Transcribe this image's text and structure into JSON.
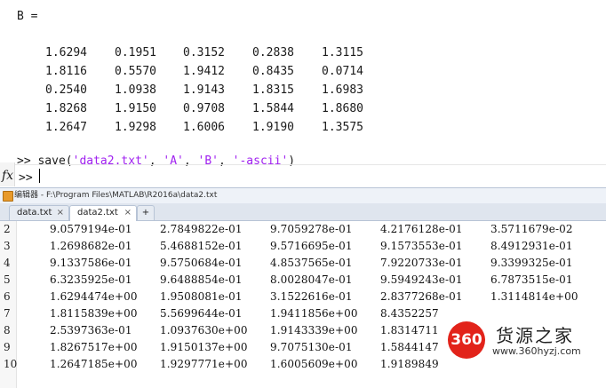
{
  "command_window": {
    "var_label": "B =",
    "matrix": [
      [
        "1.6294",
        "0.1951",
        "0.3152",
        "0.2838",
        "1.3115"
      ],
      [
        "1.8116",
        "0.5570",
        "1.9412",
        "0.8435",
        "0.0714"
      ],
      [
        "0.2540",
        "1.0938",
        "1.9143",
        "1.8315",
        "1.6983"
      ],
      [
        "1.8268",
        "1.9150",
        "0.9708",
        "1.5844",
        "1.8680"
      ],
      [
        "1.2647",
        "1.9298",
        "1.6006",
        "1.9190",
        "1.3575"
      ]
    ],
    "prompt": ">>",
    "command_prefix": "save(",
    "arg1": "'data2.txt'",
    "sep1": ", ",
    "arg2": "'A'",
    "sep2": ", ",
    "arg3": "'B'",
    "sep3": ", ",
    "arg4": "'-ascii'",
    "command_suffix": ")",
    "fx_symbol": "fx",
    "prompt2": ">>"
  },
  "editor": {
    "title": "编辑器 - F:\\Program Files\\MATLAB\\R2016a\\data2.txt",
    "tabs": [
      {
        "label": "data.txt",
        "close": "×"
      },
      {
        "label": "data2.txt",
        "close": "×"
      }
    ],
    "add_tab": "+",
    "lines": [
      {
        "num": "2",
        "values": [
          "9.0579194e-01",
          "2.7849822e-01",
          "9.7059278e-01",
          "4.2176128e-01",
          "3.5711679e-02"
        ]
      },
      {
        "num": "3",
        "values": [
          "1.2698682e-01",
          "5.4688152e-01",
          "9.5716695e-01",
          "9.1573553e-01",
          "8.4912931e-01"
        ]
      },
      {
        "num": "4",
        "values": [
          "9.1337586e-01",
          "9.5750684e-01",
          "4.8537565e-01",
          "7.9220733e-01",
          "9.3399325e-01"
        ]
      },
      {
        "num": "5",
        "values": [
          "6.3235925e-01",
          "9.6488854e-01",
          "8.0028047e-01",
          "9.5949243e-01",
          "6.7873515e-01"
        ]
      },
      {
        "num": "6",
        "values": [
          "1.6294474e+00",
          "1.9508081e-01",
          "3.1522616e-01",
          "2.8377268e-01",
          "1.3114814e+00"
        ]
      },
      {
        "num": "7",
        "values": [
          "1.8115839e+00",
          "5.5699644e-01",
          "1.9411856e+00",
          "8.4352257",
          ""
        ]
      },
      {
        "num": "8",
        "values": [
          "2.5397363e-01",
          "1.0937630e+00",
          "1.9143339e+00",
          "1.8314711",
          ""
        ]
      },
      {
        "num": "9",
        "values": [
          "1.8267517e+00",
          "1.9150137e+00",
          "9.7075130e-01",
          "1.5844147",
          ""
        ]
      },
      {
        "num": "10",
        "values": [
          "1.2647185e+00",
          "1.9297771e+00",
          "1.6005609e+00",
          "1.9189849",
          ""
        ]
      }
    ]
  },
  "watermark": {
    "badge": "360",
    "title": "货源之家",
    "url": "www.360hyzj.com"
  }
}
